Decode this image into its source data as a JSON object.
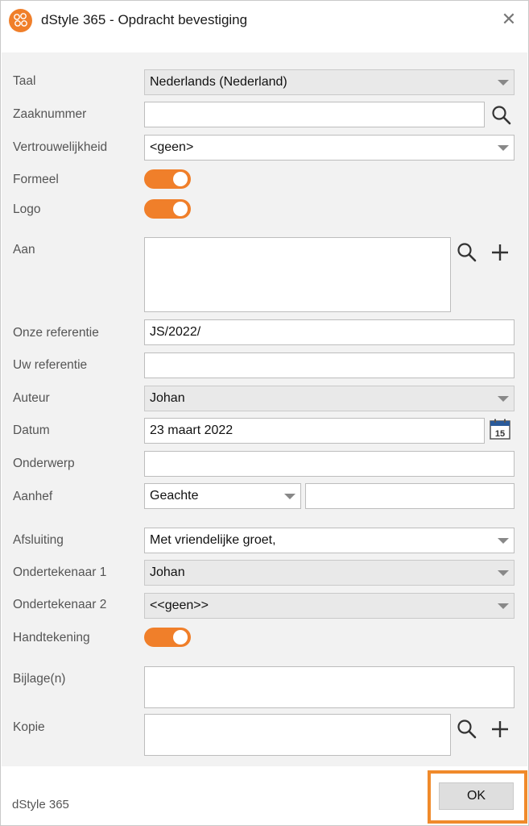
{
  "window": {
    "title": "dStyle 365 - Opdracht bevestiging",
    "close_glyph": "✕",
    "accent_color": "#f07f2a"
  },
  "form": {
    "taal": {
      "label": "Taal",
      "value": "Nederlands (Nederland)"
    },
    "zaaknummer": {
      "label": "Zaaknummer",
      "value": ""
    },
    "vertrouwelijkheid": {
      "label": "Vertrouwelijkheid",
      "value": "<geen>"
    },
    "formeel": {
      "label": "Formeel",
      "on": true
    },
    "logo": {
      "label": "Logo",
      "on": true
    },
    "aan": {
      "label": "Aan",
      "value": ""
    },
    "onze_referentie": {
      "label": "Onze referentie",
      "value": "JS/2022/"
    },
    "uw_referentie": {
      "label": "Uw referentie",
      "value": ""
    },
    "auteur": {
      "label": "Auteur",
      "value": "Johan"
    },
    "datum": {
      "label": "Datum",
      "value": "23 maart 2022",
      "calendar_day": "15"
    },
    "onderwerp": {
      "label": "Onderwerp",
      "value": ""
    },
    "aanhef": {
      "label": "Aanhef",
      "value": "Geachte",
      "name_value": ""
    },
    "afsluiting": {
      "label": "Afsluiting",
      "value": "Met vriendelijke groet,"
    },
    "ondertekenaar1": {
      "label": "Ondertekenaar 1",
      "value": "Johan"
    },
    "ondertekenaar2": {
      "label": "Ondertekenaar 2",
      "value": "<<geen>>"
    },
    "handtekening": {
      "label": "Handtekening",
      "on": true
    },
    "bijlagen": {
      "label": "Bijlage(n)",
      "value": ""
    },
    "kopie": {
      "label": "Kopie",
      "value": ""
    }
  },
  "icons": {
    "search": "search-icon",
    "add": "plus-icon",
    "calendar": "calendar-icon",
    "dropdown": "chevron-down-icon"
  },
  "footer": {
    "brand": "dStyle 365",
    "ok_label": "OK"
  }
}
